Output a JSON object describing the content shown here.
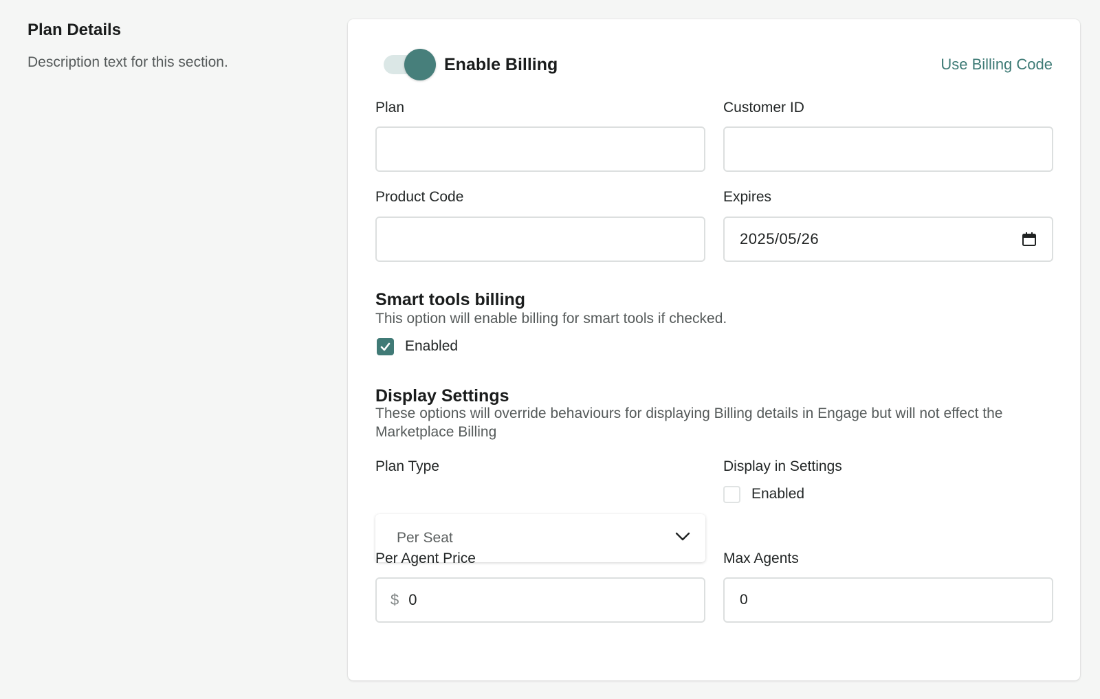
{
  "section": {
    "title": "Plan Details",
    "description": "Description text for this section."
  },
  "billing": {
    "toggle_label": "Enable Billing",
    "toggle_on": true,
    "link_label": "Use Billing Code"
  },
  "fields": {
    "plan_label": "Plan",
    "plan_value": "",
    "customer_id_label": "Customer ID",
    "customer_id_value": "",
    "product_code_label": "Product Code",
    "product_code_value": "",
    "expires_label": "Expires",
    "expires_value": "2025/05/26"
  },
  "smart_tools": {
    "heading": "Smart tools billing",
    "description": "This option will enable billing for smart tools if checked.",
    "checkbox_label": "Enabled",
    "checked": true
  },
  "display_settings": {
    "heading": "Display Settings",
    "description": "These options will override behaviours for displaying Billing details in Engage but will not effect the Marketplace Billing",
    "plan_type_label": "Plan Type",
    "plan_type_value": "Per Seat",
    "display_in_settings_label": "Display in Settings",
    "display_checkbox_label": "Enabled",
    "display_checked": false,
    "per_agent_price_label": "Per Agent Price",
    "currency_prefix": "$",
    "per_agent_price_value": "0",
    "max_agents_label": "Max Agents",
    "max_agents_value": "0"
  },
  "colors": {
    "accent": "#477f7b",
    "link": "#3d7a75",
    "toggle_track": "#dbe7e6"
  }
}
